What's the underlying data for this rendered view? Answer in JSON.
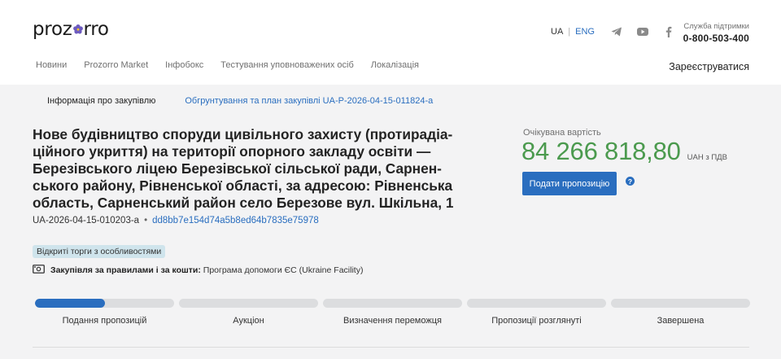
{
  "header": {
    "logo": {
      "pre": "proz",
      "post": "rro"
    },
    "lang": {
      "ua": "UA",
      "eng": "ENG"
    },
    "support": {
      "label": "Служба підтримки",
      "phone": "0-800-503-400"
    },
    "nav": [
      "Новини",
      "Prozorro Market",
      "Інфобокс",
      "Тестування уповноважених осіб",
      "Локалізація"
    ],
    "register": "Зареєструватися"
  },
  "tabs": {
    "info": "Інформація про закупівлю",
    "plan": "Обгрунтування та план закупівлі UA-P-2026-04-15-011824-a"
  },
  "tender": {
    "title": "Нове будівництво споруди цивільного захисту (протирадіа­ційного укриття) на території опорного закладу освіти — Березівського ліцею Березівської сільської ради, Сарнен­ського району, Рівненської області, за адресою: Рівненська область, Сарненський район село Березове вул. Шкільна, 1",
    "id": "UA-2026-04-15-010203-a",
    "hash": "dd8bb7e154d74a5b8ed64b7835e75978",
    "badge": "Відкриті торги з особливостями",
    "rules_label": "Закупівля за правилами і за кошти:",
    "rules_value": "Програма допомоги ЄС (Ukraine Facility)"
  },
  "price": {
    "label": "Очікувана вартість",
    "amount": "84 266 818,80",
    "currency": "UAH з ПДВ"
  },
  "submit_label": "Подати пропозицію",
  "help": "?",
  "stages": [
    {
      "label": "Подання пропозицій",
      "progress": 0.5
    },
    {
      "label": "Аукціон",
      "progress": 0
    },
    {
      "label": "Визначення переможця",
      "progress": 0
    },
    {
      "label": "Пропозиції розглянуті",
      "progress": 0
    },
    {
      "label": "Завершена",
      "progress": 0
    }
  ],
  "colors": {
    "accent": "#2a6ebf",
    "price": "#4b9a4e",
    "badge_bg": "#cfe4ec"
  },
  "icons": [
    "telegram-icon",
    "youtube-icon",
    "facebook-icon",
    "money-icon",
    "help-icon"
  ]
}
